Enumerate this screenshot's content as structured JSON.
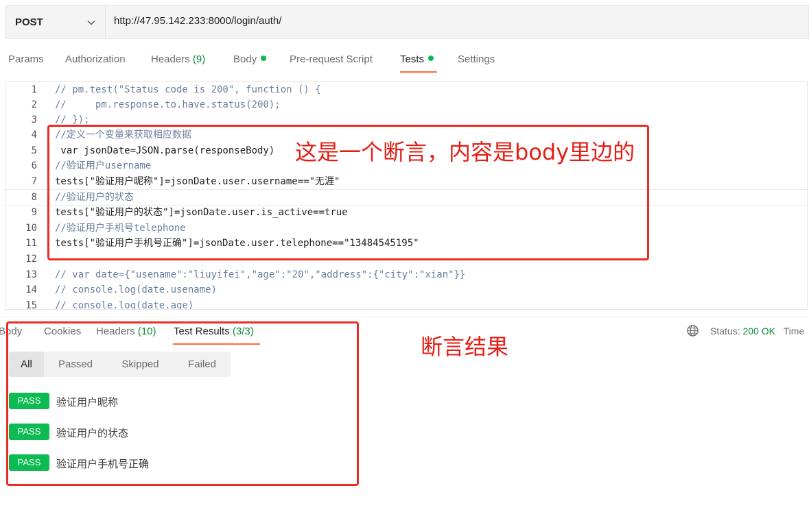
{
  "request": {
    "method": "POST",
    "url": "http://47.95.142.233:8000/login/auth/"
  },
  "request_tabs": {
    "params": "Params",
    "authorization": "Authorization",
    "headers": "Headers",
    "headers_count": "(9)",
    "body": "Body",
    "pre_request": "Pre-request Script",
    "tests": "Tests",
    "settings": "Settings"
  },
  "editor": {
    "lines": [
      {
        "n": "1",
        "text": "// pm.test(\"Status code is 200\", function () {"
      },
      {
        "n": "2",
        "text": "//     pm.response.to.have.status(200);"
      },
      {
        "n": "3",
        "text": "// });"
      },
      {
        "n": "4",
        "text": "//定义一个变量来获取相应数据"
      },
      {
        "n": "5",
        "text": " var jsonDate=JSON.parse(responseBody)"
      },
      {
        "n": "6",
        "text": "//验证用户username"
      },
      {
        "n": "7",
        "text": "tests[\"验证用户昵称\"]=jsonDate.user.username==\"无涯\""
      },
      {
        "n": "8",
        "text": "//验证用户的状态"
      },
      {
        "n": "9",
        "text": "tests[\"验证用户的状态\"]=jsonDate.user.is_active==true"
      },
      {
        "n": "10",
        "text": "//验证用户手机号telephone"
      },
      {
        "n": "11",
        "text": "tests[\"验证用户手机号正确\"]=jsonDate.user.telephone==\"13484545195\""
      },
      {
        "n": "12",
        "text": ""
      },
      {
        "n": "13",
        "text": "// var date={\"usename\":\"liuyifei\",\"age\":\"20\",\"address\":{\"city\":\"xian\"}}"
      },
      {
        "n": "14",
        "text": "// console.log(date.usename)"
      },
      {
        "n": "15",
        "text": "// console.log(date.age)"
      }
    ]
  },
  "annotations": {
    "code_note": "这是一个断言，内容是body里边的",
    "result_note": "断言结果"
  },
  "response_tabs": {
    "body": "Body",
    "cookies": "Cookies",
    "headers": "Headers",
    "headers_count": "(10)",
    "test_results": "Test Results",
    "test_results_count": "(3/3)"
  },
  "status": {
    "label": "Status:",
    "value": "200 OK",
    "time_label": "Time"
  },
  "filters": [
    "All",
    "Passed",
    "Skipped",
    "Failed"
  ],
  "results": [
    {
      "badge": "PASS",
      "name": "验证用户昵称"
    },
    {
      "badge": "PASS",
      "name": "验证用户的状态"
    },
    {
      "badge": "PASS",
      "name": "验证用户手机号正确"
    }
  ],
  "colors": {
    "accent": "#ff6c37",
    "pass": "#0cbb52",
    "annotation": "#ee2a24"
  }
}
